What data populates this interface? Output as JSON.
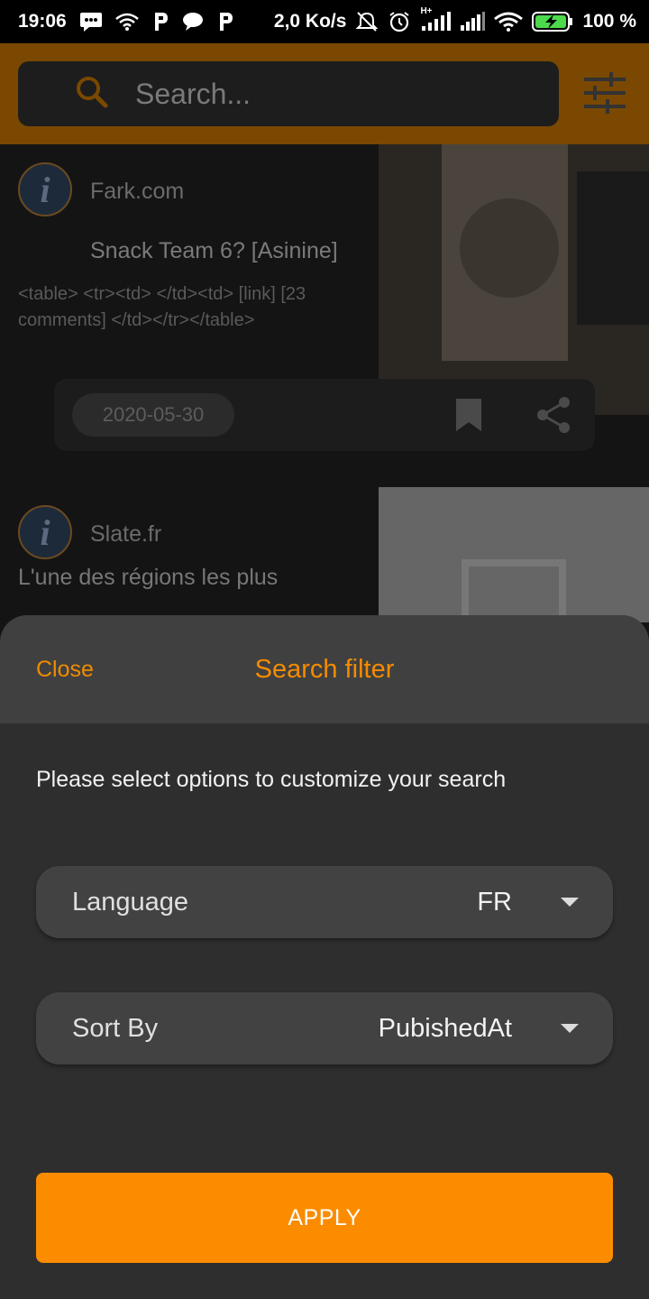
{
  "status_bar": {
    "time": "19:06",
    "network_speed": "2,0 Ko/s",
    "network_type": "H+",
    "battery": "100 %",
    "icons": [
      "message-icon",
      "wifi-icon",
      "p-app-icon",
      "chat-icon",
      "p-app-icon",
      "mute-icon",
      "alarm-icon",
      "signal-icon",
      "signal-icon",
      "wifi-icon",
      "battery-charging-icon"
    ]
  },
  "search": {
    "placeholder": "Search..."
  },
  "feed": [
    {
      "source": "Fark.com",
      "title": "Snack Team 6? [Asinine]",
      "snippet": "<table> <tr><td> </td><td> [link] [23 comments] </td></tr></table>",
      "date": "2020-05-30"
    },
    {
      "source": "Slate.fr",
      "title": "L'une des régions les plus"
    }
  ],
  "sheet": {
    "close_label": "Close",
    "title": "Search filter",
    "prompt": "Please select options to customize your search",
    "language": {
      "label": "Language",
      "value": "FR"
    },
    "sort_by": {
      "label": "Sort By",
      "value": "PubishedAt"
    },
    "apply_label": "APPLY"
  },
  "colors": {
    "accent": "#fb8c00",
    "sheet_background": "#2e2e2e",
    "sheet_header": "#404040",
    "select_background": "#424242"
  }
}
